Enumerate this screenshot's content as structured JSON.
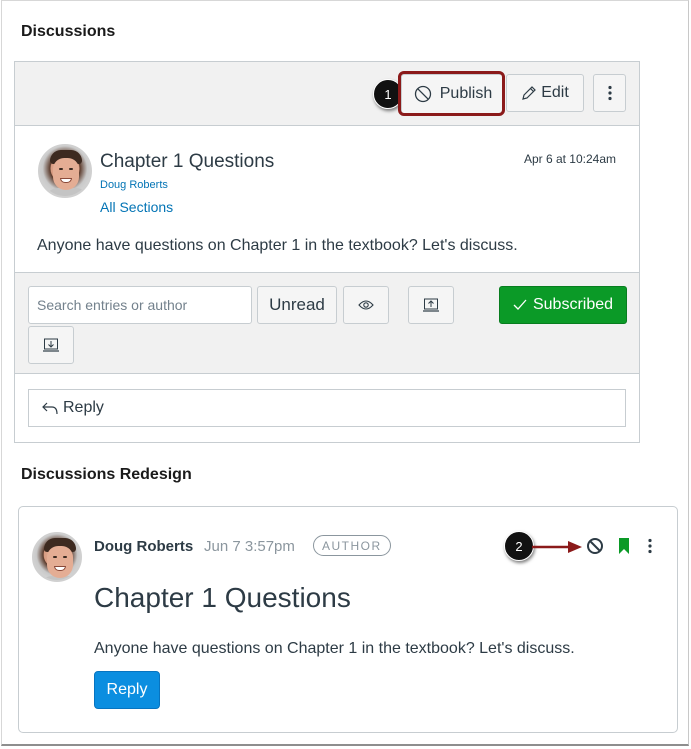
{
  "sections": {
    "old_title": "Discussions",
    "new_title": "Discussions Redesign"
  },
  "old_discussion": {
    "toolbar": {
      "publish_label": "Publish",
      "edit_label": "Edit",
      "callout_number": "1"
    },
    "topic": {
      "title": "Chapter 1 Questions",
      "author": "Doug Roberts",
      "sections": "All Sections",
      "date": "Apr 6 at 10:24am",
      "body": "Anyone have questions on Chapter 1 in the textbook? Let's discuss."
    },
    "filter": {
      "search_placeholder": "Search entries or author",
      "search_value": "",
      "unread_label": "Unread",
      "subscribed_label": "Subscribed"
    },
    "reply_label": "Reply"
  },
  "new_discussion": {
    "author": "Doug Roberts",
    "date": "Jun 7 3:57pm",
    "badge": "AUTHOR",
    "title": "Chapter 1 Questions",
    "body": "Anyone have questions on Chapter 1 in the textbook? Let's discuss.",
    "reply_label": "Reply",
    "callout_number": "2"
  },
  "colors": {
    "link": "#0374b5",
    "subscribed_green": "#0b9a27",
    "reply_blue": "#0b8ee0",
    "highlight_red": "#8b1a1a",
    "bookmark_green": "#0b9a27"
  }
}
